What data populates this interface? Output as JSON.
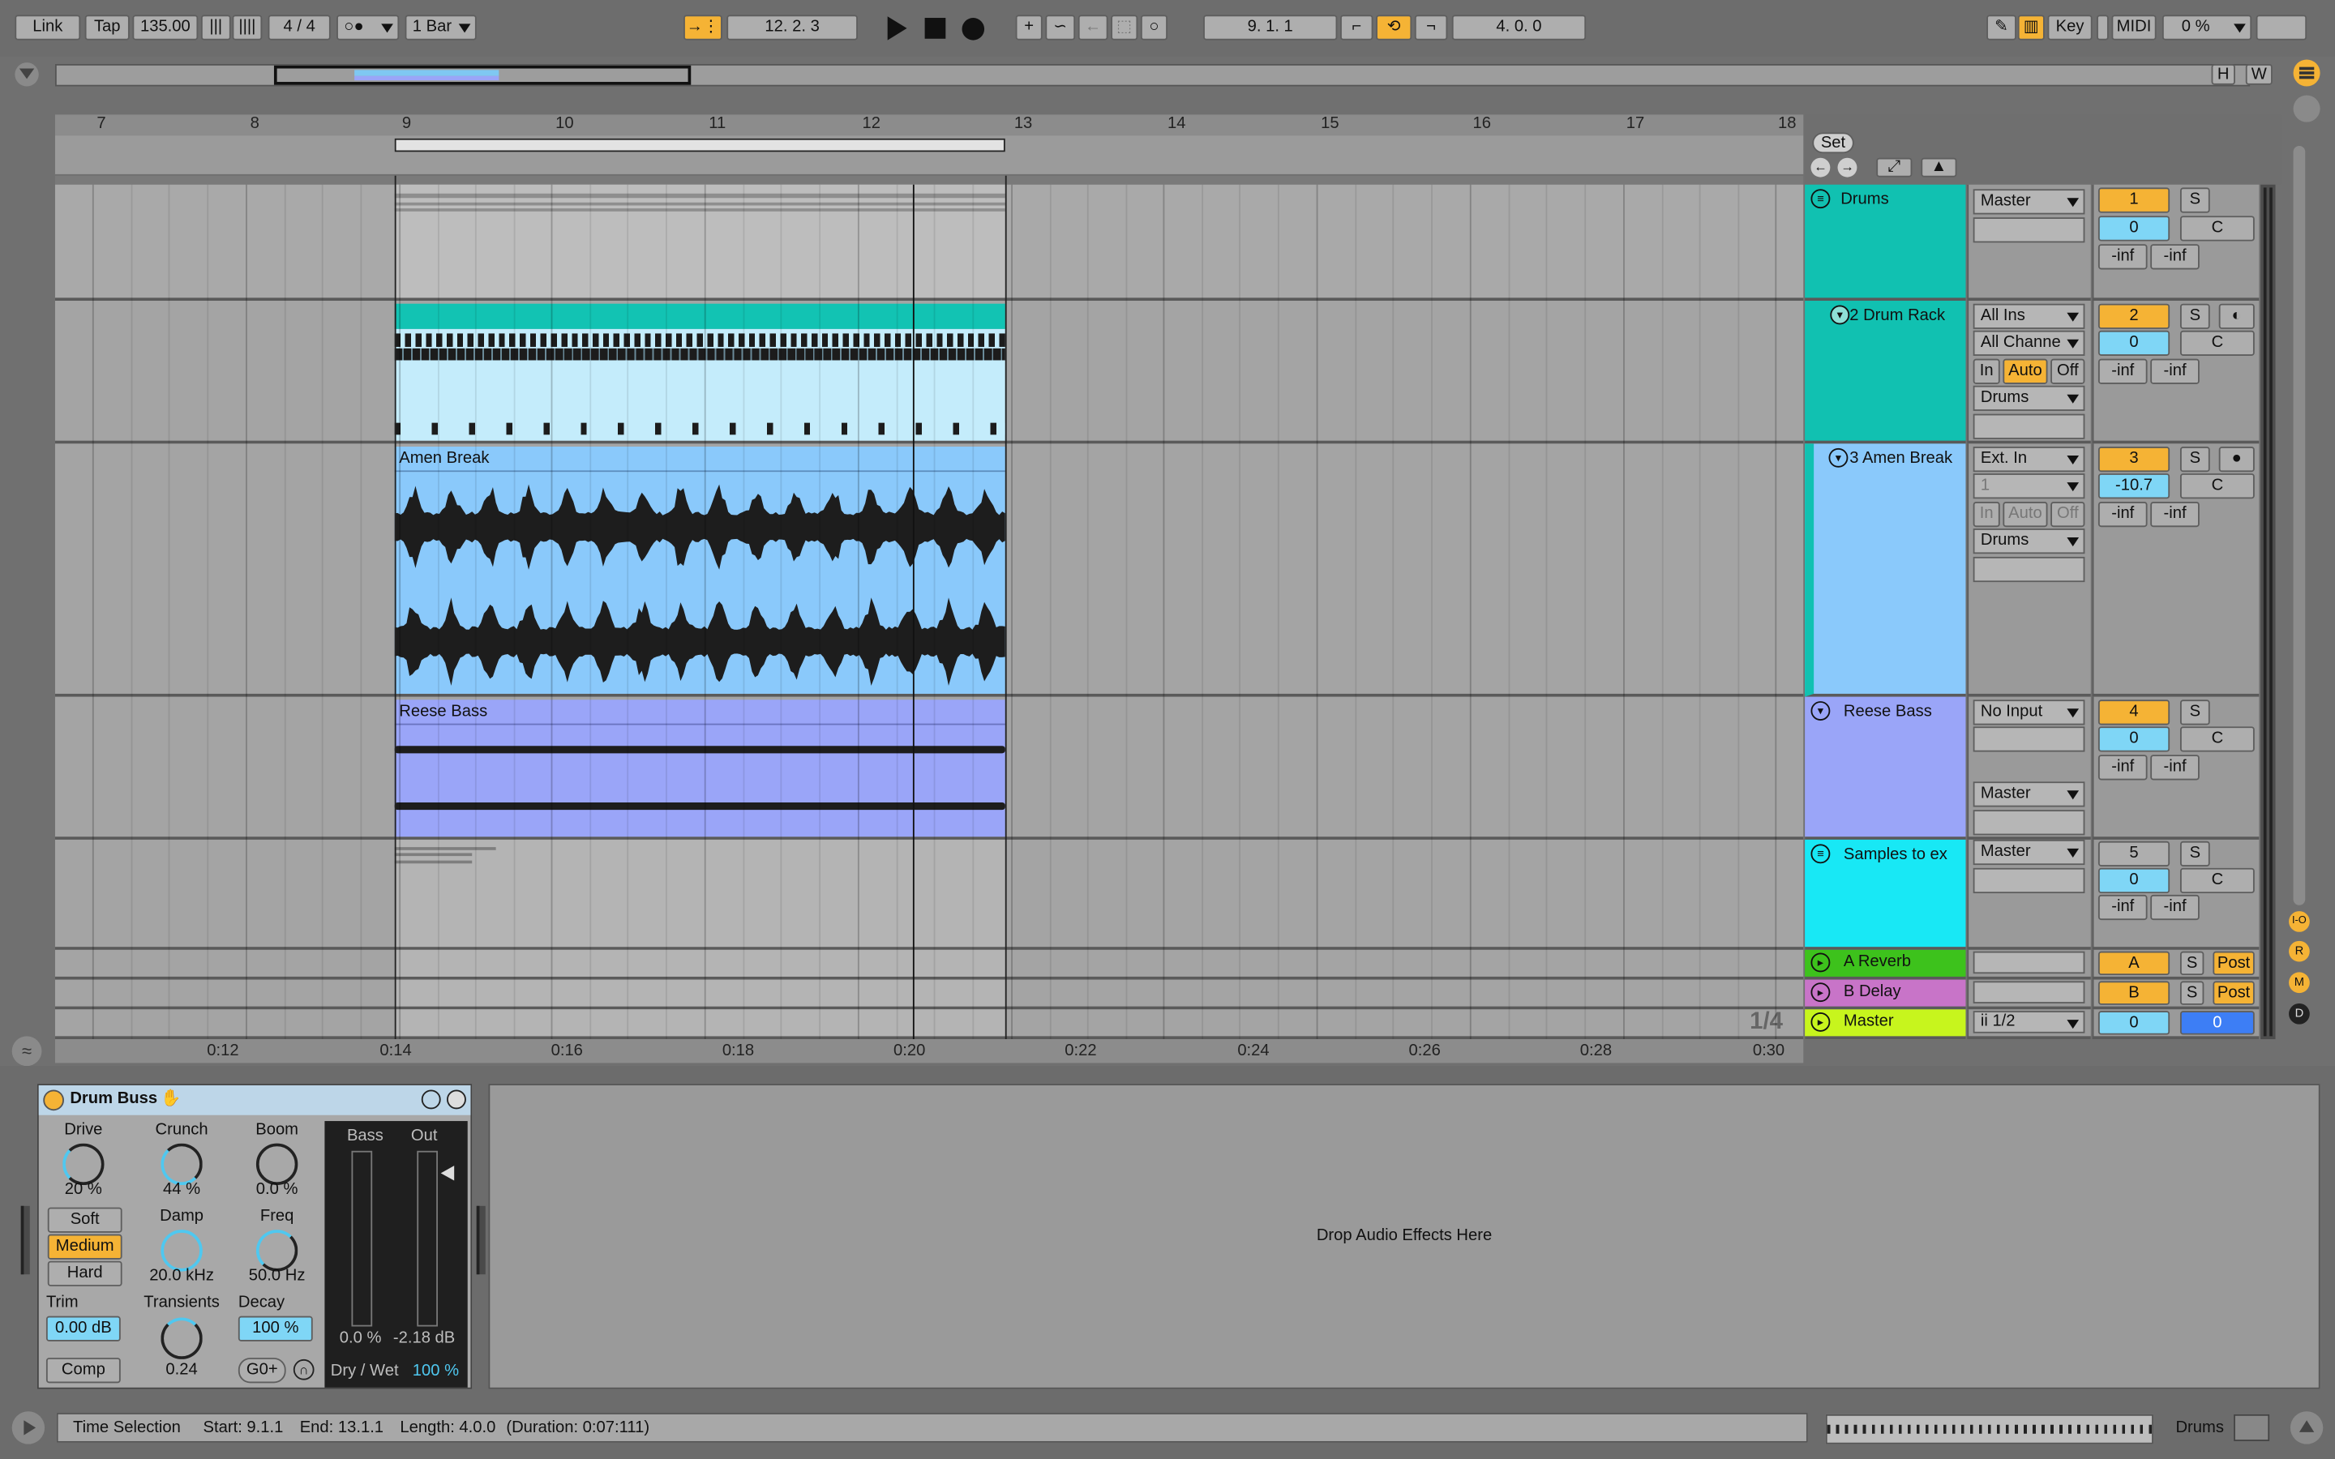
{
  "transport": {
    "link": "Link",
    "tap": "Tap",
    "tempo": "135.00",
    "signature": "4 / 4",
    "quantize": "1 Bar",
    "position": "12.  2.  3",
    "loop_start": "9.  1.  1",
    "loop_length": "4.  0.  0",
    "key": "Key",
    "midi": "MIDI",
    "cpu": "0 %"
  },
  "overview": {
    "h": "H",
    "w": "W"
  },
  "ruler": {
    "bars": [
      "7",
      "8",
      "9",
      "10",
      "11",
      "12",
      "13",
      "14",
      "15",
      "16",
      "17",
      "18"
    ],
    "times": [
      "0:12",
      "0:14",
      "0:16",
      "0:18",
      "0:20",
      "0:22",
      "0:24",
      "0:26",
      "0:28",
      "0:30"
    ],
    "zoom": "1/4",
    "set": "Set"
  },
  "tracks": {
    "drums": {
      "name": "Drums",
      "output": "Master",
      "number": "1",
      "solo": "S",
      "volume": "0",
      "pan": "C",
      "peak_l": "-inf",
      "peak_r": "-inf",
      "color": "#11c1b1"
    },
    "drum_rack": {
      "name": "2 Drum Rack",
      "input_type": "All Ins",
      "input_channel": "All Channe",
      "mon_in": "In",
      "mon_auto": "Auto",
      "mon_off": "Off",
      "output": "Drums",
      "number": "2",
      "solo": "S",
      "volume": "0",
      "pan": "C",
      "peak_l": "-inf",
      "peak_r": "-inf"
    },
    "amen": {
      "name": "3 Amen Break",
      "clip": "Amen Break",
      "input_type": "Ext. In",
      "input_channel": "1",
      "mon_in": "In",
      "mon_auto": "Auto",
      "mon_off": "Off",
      "output": "Drums",
      "number": "3",
      "solo": "S",
      "volume": "-10.7",
      "pan": "C",
      "peak_l": "-inf",
      "peak_r": "-inf",
      "color": "#8ac9fb"
    },
    "reese": {
      "name": "Reese Bass",
      "clip": "Reese Bass",
      "input_type": "No Input",
      "output": "Master",
      "number": "4",
      "solo": "S",
      "volume": "0",
      "pan": "C",
      "peak_l": "-inf",
      "peak_r": "-inf",
      "color": "#9aa5f8"
    },
    "samples": {
      "name": "Samples to ex",
      "output": "Master",
      "number": "5",
      "solo": "S",
      "volume": "0",
      "pan": "C",
      "peak_l": "-inf",
      "peak_r": "-inf",
      "color": "#18e8f5"
    },
    "reverb": {
      "name": "A Reverb",
      "letter": "A",
      "solo": "S",
      "post": "Post",
      "color": "#3dc21c"
    },
    "delay": {
      "name": "B Delay",
      "letter": "B",
      "solo": "S",
      "post": "Post",
      "color": "#c874c8"
    },
    "master": {
      "name": "Master",
      "cue": "ii 1/2",
      "volume": "0",
      "cue_volume": "0",
      "color": "#c7f51d"
    }
  },
  "side_letters": [
    "I-O",
    "R",
    "M",
    "D"
  ],
  "device": {
    "title": "Drum Buss",
    "drive_label": "Drive",
    "drive": "20 %",
    "crunch_label": "Crunch",
    "crunch": "44 %",
    "boom_label": "Boom",
    "boom": "0.0 %",
    "soft": "Soft",
    "medium": "Medium",
    "hard": "Hard",
    "damp_label": "Damp",
    "damp": "20.0 kHz",
    "freq_label": "Freq",
    "freq": "50.0 Hz",
    "trim_label": "Trim",
    "trim": "0.00 dB",
    "transients_label": "Transients",
    "transients": "0.24",
    "decay_label": "Decay",
    "decay": "100 %",
    "comp": "Comp",
    "goplus": "G0+",
    "bass_label": "Bass",
    "out_label": "Out",
    "bass_value": "0.0 %",
    "out_value": "-2.18 dB",
    "drywet_label": "Dry / Wet",
    "drywet": "100 %"
  },
  "drop_zone": "Drop Audio Effects Here",
  "status": {
    "label": "Time Selection",
    "start": "Start: 9.1.1",
    "end": "End: 13.1.1",
    "length": "Length: 4.0.0",
    "duration": "(Duration: 0:07:111)",
    "track": "Drums"
  }
}
